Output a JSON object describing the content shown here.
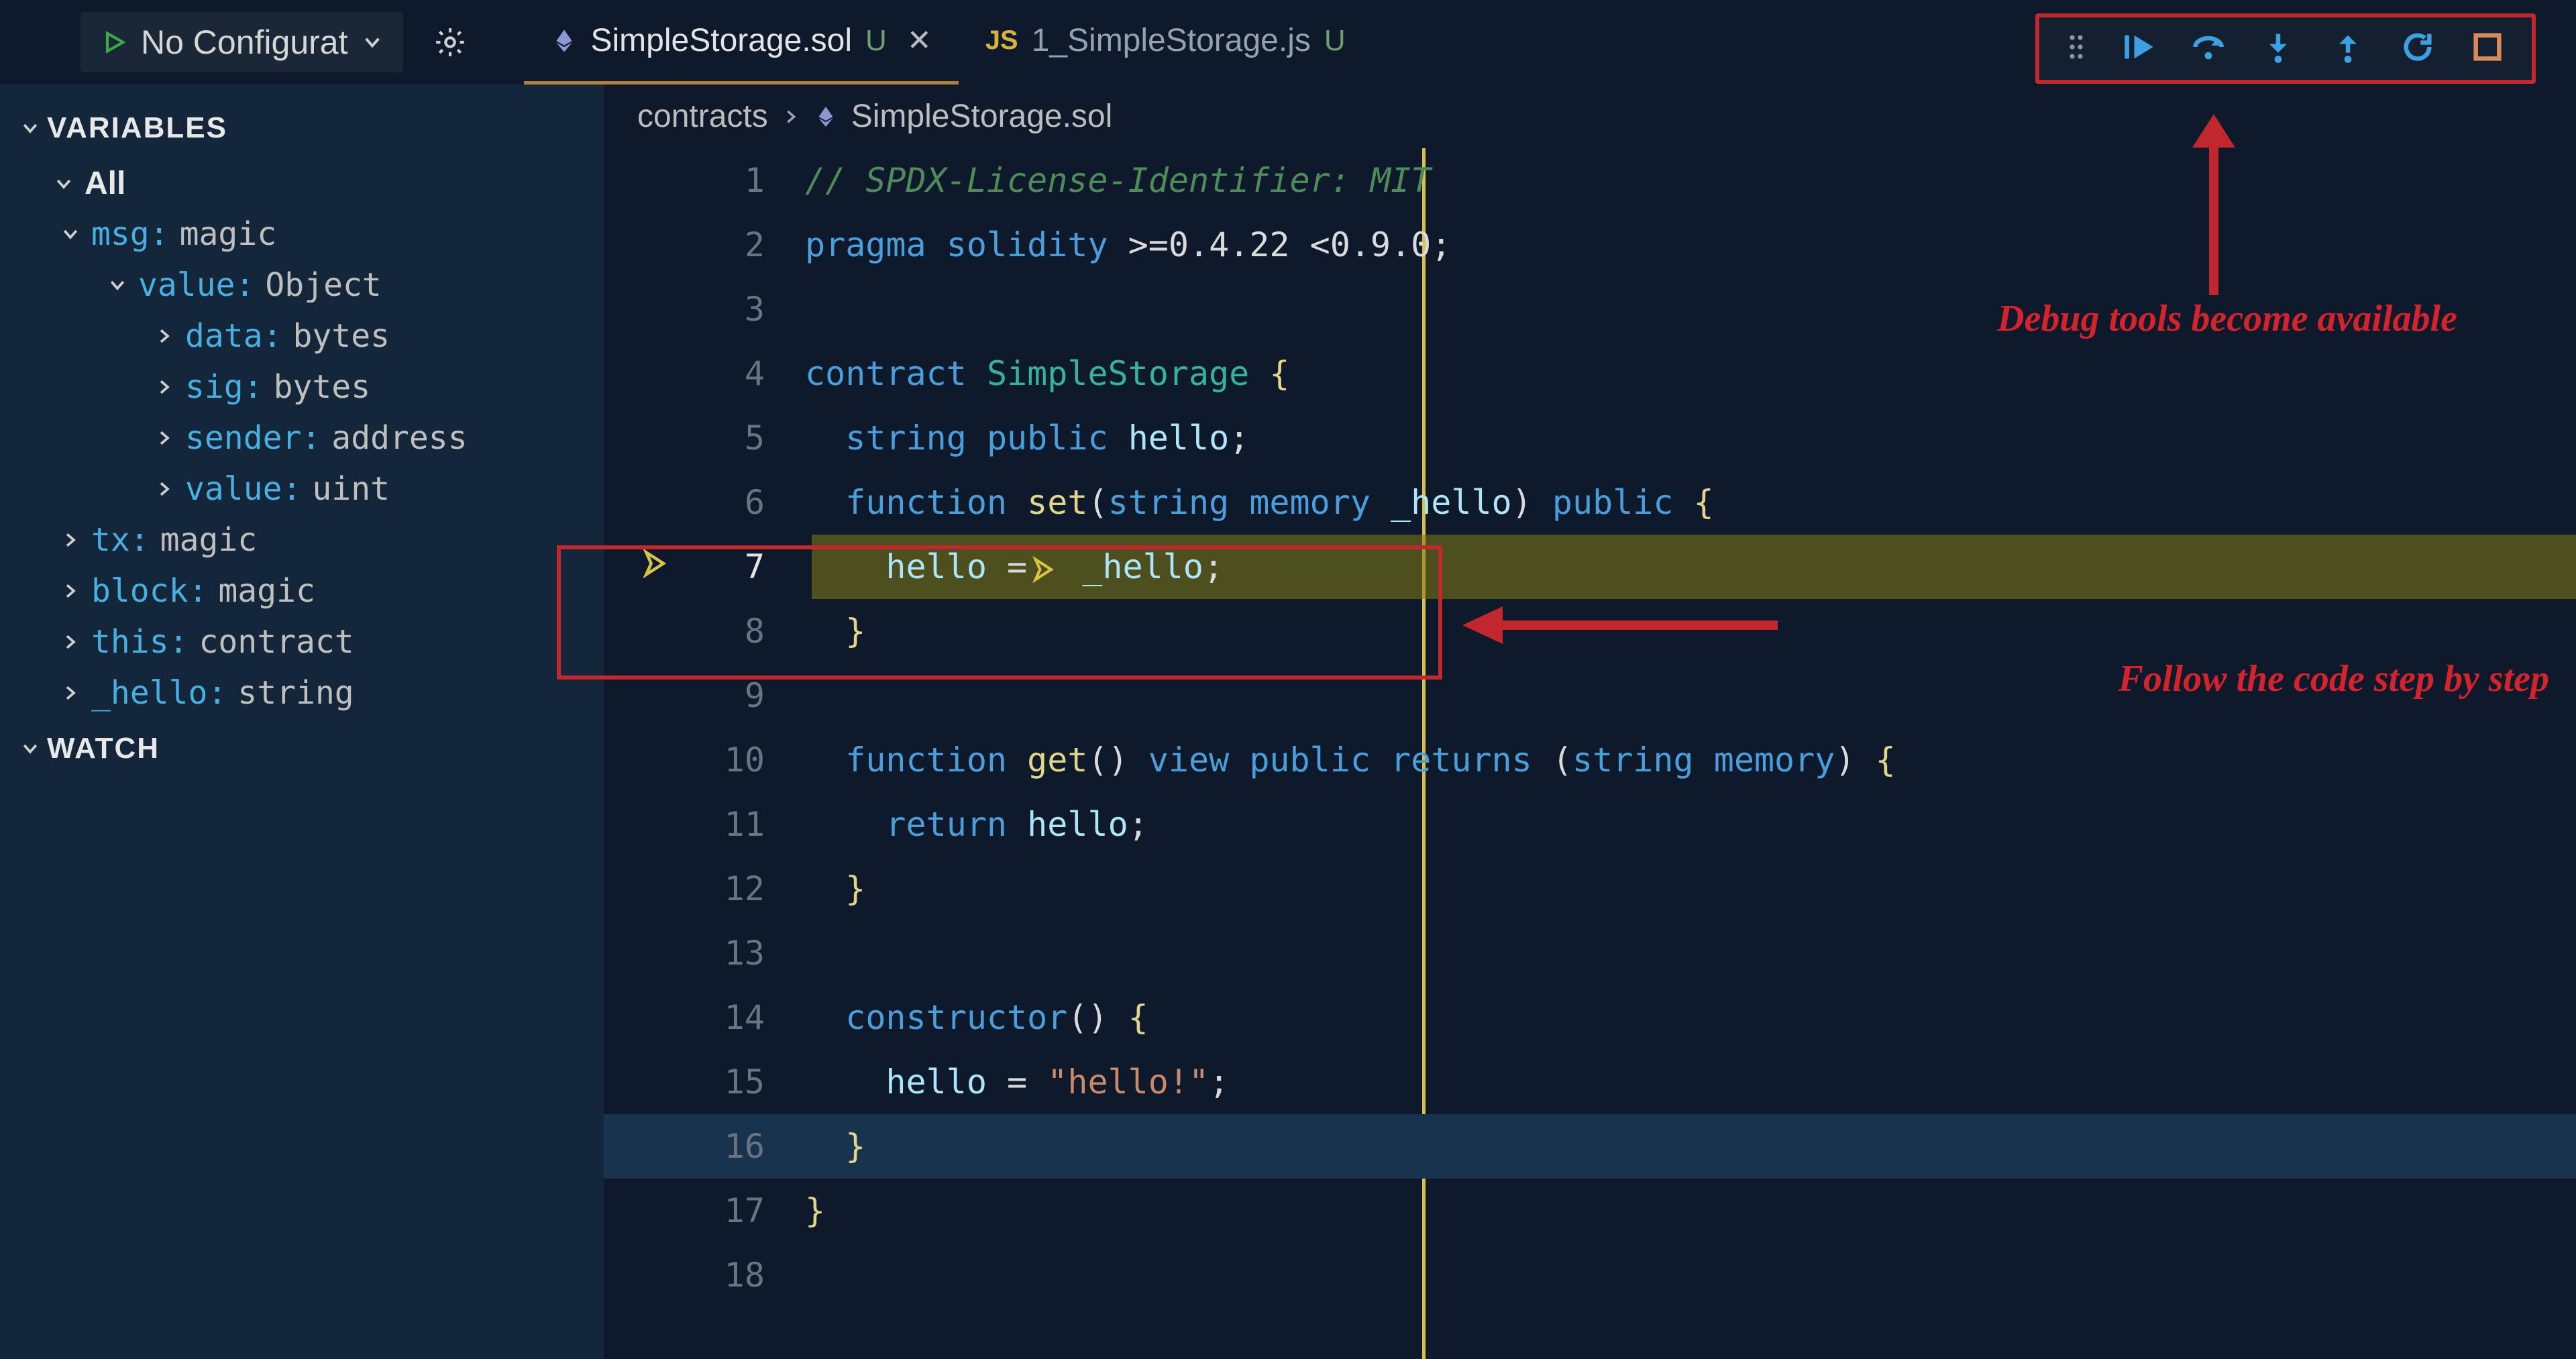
{
  "topbar": {
    "config_label": "No Configurat"
  },
  "tabs": [
    {
      "icon": "eth",
      "label": "SimpleStorage.sol",
      "status": "U",
      "active": true,
      "closable": true
    },
    {
      "icon": "js",
      "label": "1_SimpleStorage.js",
      "status": "U",
      "active": false,
      "closable": false
    }
  ],
  "sidebar": {
    "sections": {
      "variables_label": "VARIABLES",
      "watch_label": "WATCH"
    },
    "scope_label": "All",
    "vars": [
      {
        "depth": 1,
        "expanded": true,
        "key": "msg",
        "val": "magic"
      },
      {
        "depth": 2,
        "expanded": true,
        "key": "value",
        "val": "Object"
      },
      {
        "depth": 3,
        "expanded": false,
        "key": "data",
        "val": "bytes"
      },
      {
        "depth": 3,
        "expanded": false,
        "key": "sig",
        "val": "bytes"
      },
      {
        "depth": 3,
        "expanded": false,
        "key": "sender",
        "val": "address"
      },
      {
        "depth": 3,
        "expanded": false,
        "key": "value",
        "val": "uint"
      },
      {
        "depth": 1,
        "expanded": false,
        "key": "tx",
        "val": "magic"
      },
      {
        "depth": 1,
        "expanded": false,
        "key": "block",
        "val": "magic"
      },
      {
        "depth": 1,
        "expanded": false,
        "key": "this",
        "val": "contract"
      },
      {
        "depth": 1,
        "expanded": false,
        "key": "_hello",
        "val": "string"
      }
    ]
  },
  "breadcrumbs": {
    "folder": "contracts",
    "file": "SimpleStorage.sol"
  },
  "code": {
    "current_line": 7,
    "selected_line": 16,
    "lines": [
      {
        "n": 1,
        "html": "<span class='tok-comment'>// SPDX-License-Identifier: MIT</span>"
      },
      {
        "n": 2,
        "html": "<span class='tok-kw'>pragma</span> <span class='tok-kw'>solidity</span> &gt;=0.4.22 &lt;0.9.0<span class='tok-op'>;</span>"
      },
      {
        "n": 3,
        "html": ""
      },
      {
        "n": 4,
        "html": "<span class='tok-kw'>contract</span> <span class='tok-type'>SimpleStorage</span> <span class='tok-punc'>{</span>"
      },
      {
        "n": 5,
        "html": "  <span class='tok-kw'>string</span> <span class='tok-kw'>public</span> <span class='tok-ident'>hello</span><span class='tok-op'>;</span>"
      },
      {
        "n": 6,
        "html": "  <span class='tok-kw'>function</span> <span class='tok-fn'>set</span>(<span class='tok-kw'>string</span> <span class='tok-kw'>memory</span> <span class='tok-ident'>_hello</span>) <span class='tok-kw'>public</span> <span class='tok-punc'>{</span>"
      },
      {
        "n": 7,
        "html": "    <span class='tok-ident'>hello</span> =<span class='inline-pointer'><svg viewBox='0 0 24 24'><path d='M4 3 L18 12 L4 21 L8 12 Z' fill='none' stroke='#d9c24a' stroke-width='2.5'/></svg></span> <span class='tok-ident'>_hello</span><span class='tok-op'>;</span>"
      },
      {
        "n": 8,
        "html": "  <span class='tok-punc'>}</span>"
      },
      {
        "n": 9,
        "html": ""
      },
      {
        "n": 10,
        "html": "  <span class='tok-kw'>function</span> <span class='tok-fn'>get</span>() <span class='tok-kw'>view</span> <span class='tok-kw'>public</span> <span class='tok-kw'>returns</span> (<span class='tok-kw'>string</span> <span class='tok-kw'>memory</span>) <span class='tok-punc'>{</span>"
      },
      {
        "n": 11,
        "html": "    <span class='tok-kw'>return</span> <span class='tok-ident'>hello</span><span class='tok-op'>;</span>"
      },
      {
        "n": 12,
        "html": "  <span class='tok-punc'>}</span>"
      },
      {
        "n": 13,
        "html": ""
      },
      {
        "n": 14,
        "html": "  <span class='tok-kw'>constructor</span>() <span class='tok-punc'>{</span>"
      },
      {
        "n": 15,
        "html": "    <span class='tok-ident'>hello</span> = <span class='tok-str'>\"hello!\"</span><span class='tok-op'>;</span>"
      },
      {
        "n": 16,
        "html": "  <span class='tok-punc'>}</span>"
      },
      {
        "n": 17,
        "html": "<span class='tok-punc'>}</span>"
      },
      {
        "n": 18,
        "html": ""
      }
    ]
  },
  "annotations": {
    "debug_tools": "Debug tools become available",
    "follow_code": "Follow the code step by step"
  },
  "debug_buttons": [
    "continue",
    "step-over",
    "step-into",
    "step-out",
    "restart",
    "stop"
  ]
}
